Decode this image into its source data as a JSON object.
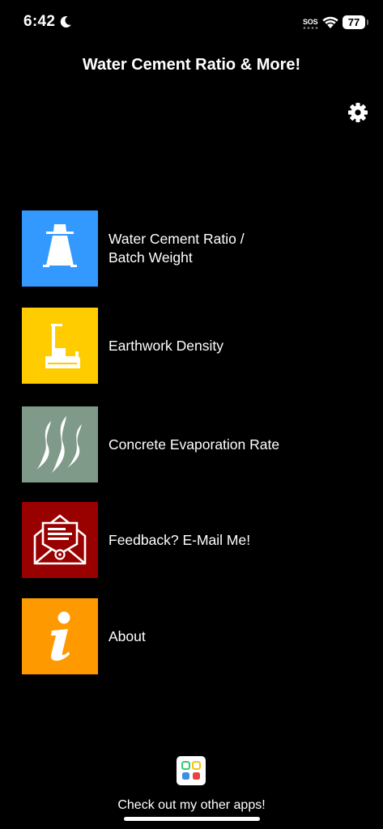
{
  "status_bar": {
    "time": "6:42",
    "sos": "SOS",
    "battery": "77"
  },
  "header": {
    "title": "Water Cement Ratio & More!"
  },
  "menu": {
    "items": [
      {
        "label": "Water Cement Ratio /\nBatch Weight",
        "color": "#3399ff",
        "icon": "slump-cone-icon"
      },
      {
        "label": "Earthwork Density",
        "color": "#ffcc00",
        "icon": "nuclear-gauge-icon"
      },
      {
        "label": "Concrete Evaporation Rate",
        "color": "#7f9a88",
        "icon": "evaporation-icon"
      },
      {
        "label": "Feedback? E-Mail Me!",
        "color": "#990000",
        "icon": "email-envelope-icon"
      },
      {
        "label": "About",
        "color": "#ff9900",
        "icon": "info-icon"
      }
    ]
  },
  "footer": {
    "other_apps_label": "Check out my other apps!"
  }
}
